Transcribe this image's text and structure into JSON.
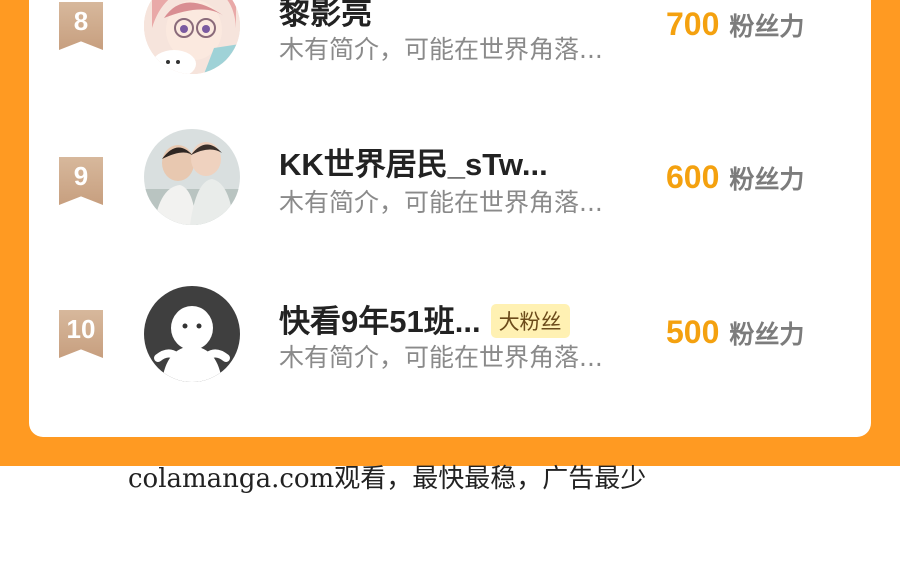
{
  "ranking": {
    "rows": [
      {
        "rank": "8",
        "name": "黎影亮",
        "fan_badge": "",
        "intro": "木有简介，可能在世界角落...",
        "score": "700",
        "score_unit": "粉丝力",
        "avatar_icon": "anime-avatar"
      },
      {
        "rank": "9",
        "name": "KK世界居民_sTw...",
        "fan_badge": "",
        "intro": "木有简介，可能在世界角落...",
        "score": "600",
        "score_unit": "粉丝力",
        "avatar_icon": "photo-avatar"
      },
      {
        "rank": "10",
        "name": "快看9年51班...",
        "fan_badge": "大粉丝",
        "intro": "木有简介，可能在世界角落...",
        "score": "500",
        "score_unit": "粉丝力",
        "avatar_icon": "default-avatar"
      }
    ]
  },
  "footer": {
    "text": "colamanga.com观看，最快最稳，广告最少"
  },
  "colors": {
    "frame": "#ff9a22",
    "score": "#f4a10f",
    "badge_bg": "#fff1b3"
  }
}
